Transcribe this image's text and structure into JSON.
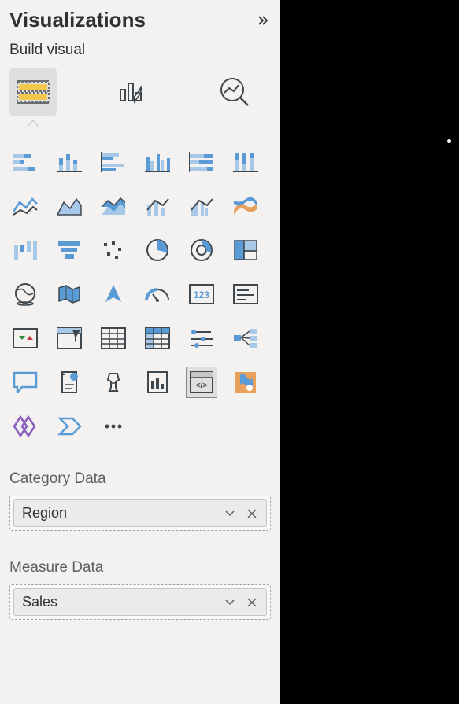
{
  "pane": {
    "title": "Visualizations",
    "subtitle": "Build visual"
  },
  "fields": {
    "category": {
      "label": "Category Data",
      "value": "Region"
    },
    "measure": {
      "label": "Measure Data",
      "value": "Sales"
    }
  },
  "colors": {
    "accent": "#3a7bd5",
    "icon_dark": "#40484f",
    "icon_blue": "#5a9bd5",
    "icon_blue_light": "#a8c8e8",
    "icon_orange": "#e8a05c",
    "yellow": "#f2c94c",
    "purple": "#8b5fbf"
  }
}
